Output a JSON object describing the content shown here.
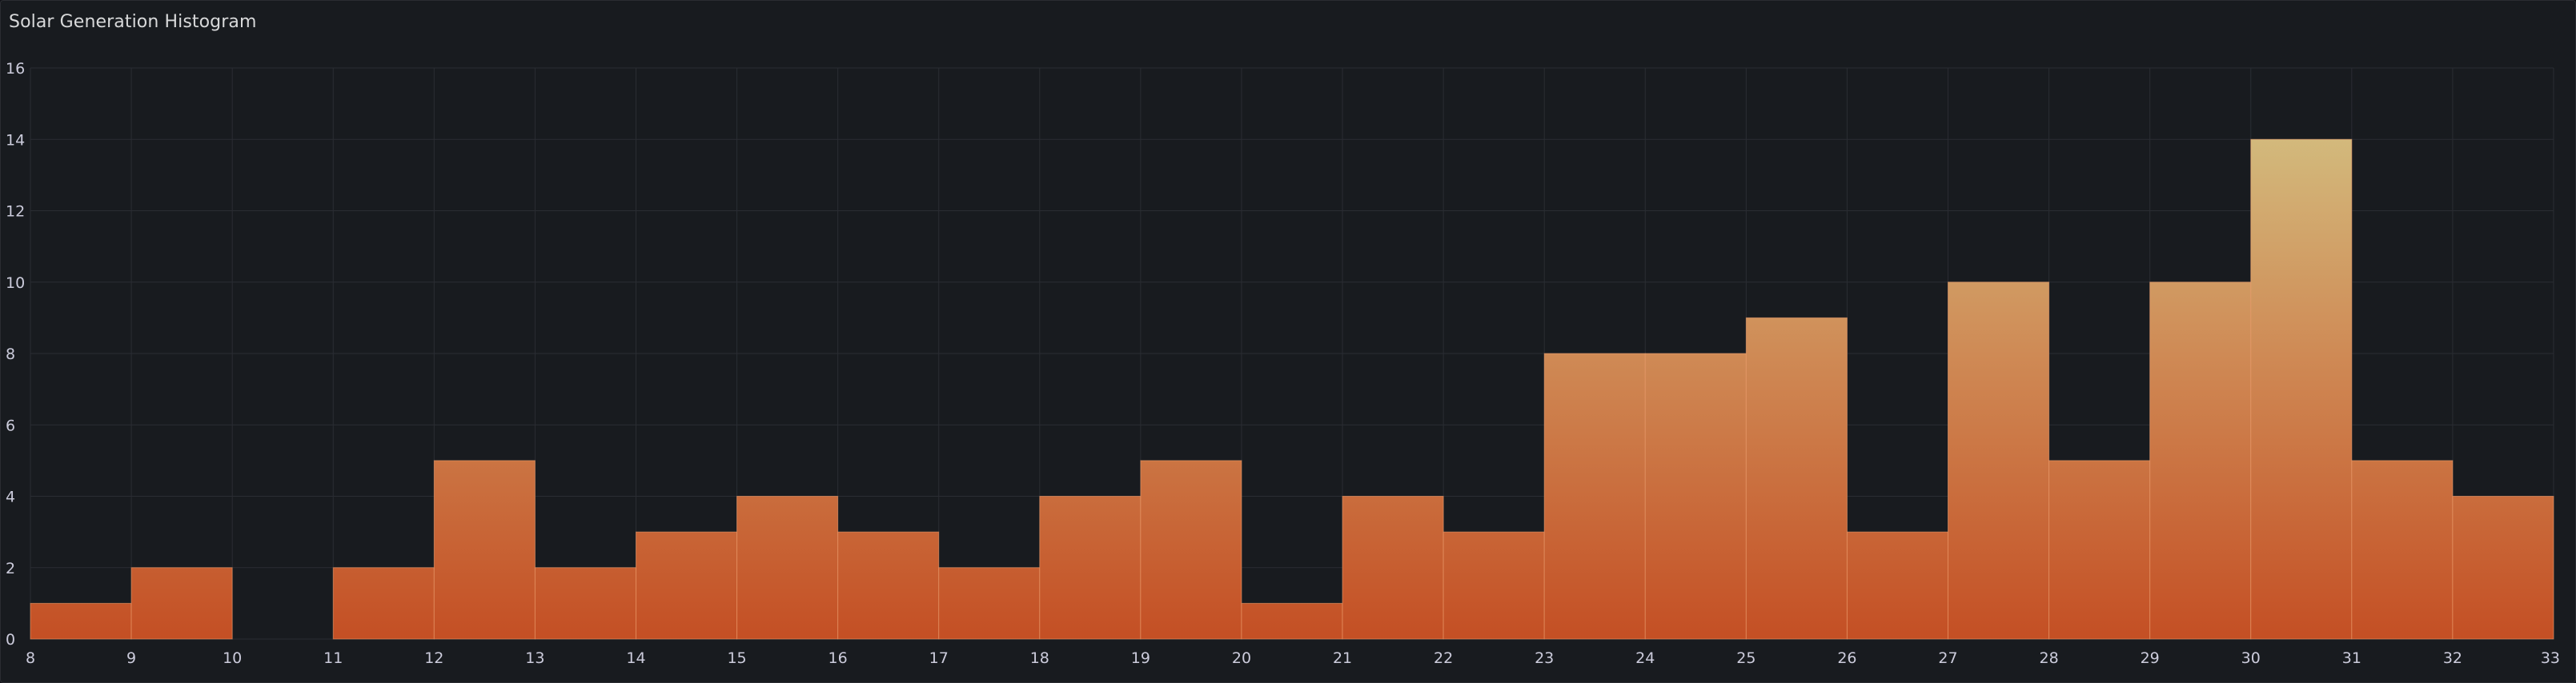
{
  "panel": {
    "title": "Solar Generation Histogram"
  },
  "chart_data": {
    "type": "bar",
    "title": "Solar Generation Histogram",
    "xlabel": "",
    "ylabel": "",
    "bin_edges": [
      8,
      9,
      10,
      11,
      12,
      13,
      14,
      15,
      16,
      17,
      18,
      19,
      20,
      21,
      22,
      23,
      24,
      25,
      26,
      27,
      28,
      29,
      30,
      31,
      32,
      33
    ],
    "values": [
      1,
      2,
      0,
      2,
      5,
      2,
      3,
      4,
      3,
      2,
      4,
      5,
      1,
      4,
      3,
      8,
      8,
      9,
      3,
      10,
      5,
      10,
      14,
      5,
      4
    ],
    "xlim": [
      8,
      33
    ],
    "ylim": [
      0,
      16
    ],
    "x_ticks": [
      8,
      9,
      10,
      11,
      12,
      13,
      14,
      15,
      16,
      17,
      18,
      19,
      20,
      21,
      22,
      23,
      24,
      25,
      26,
      27,
      28,
      29,
      30,
      31,
      32,
      33
    ],
    "y_ticks": [
      0,
      2,
      4,
      6,
      8,
      10,
      12,
      14,
      16
    ],
    "grid": true,
    "legend": "none",
    "colors": {
      "gradient_top": "#d4c888",
      "gradient_mid": "#cf8a55",
      "gradient_bottom": "#c44f24",
      "bar_stroke": "#f0a070",
      "grid": "#2a2d33",
      "background": "#181b1f"
    }
  }
}
